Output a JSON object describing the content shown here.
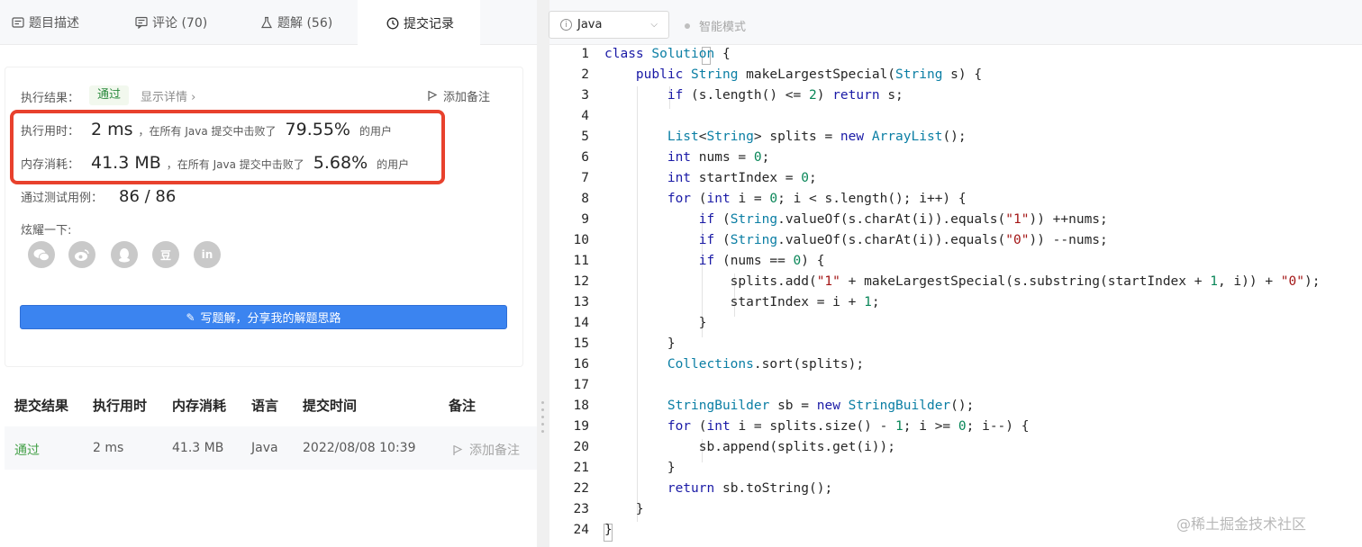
{
  "tabs": [
    {
      "label": "题目描述",
      "icon": "description-icon"
    },
    {
      "label": "评论 (70)",
      "icon": "comment-icon"
    },
    {
      "label": "题解 (56)",
      "icon": "flask-icon"
    },
    {
      "label": "提交记录",
      "icon": "clock-icon"
    }
  ],
  "result": {
    "label": "执行结果：",
    "status": "通过",
    "detail": "显示详情 ›",
    "add_note": "添加备注"
  },
  "stats": {
    "runtime_label": "执行用时：",
    "runtime_value": "2 ms",
    "runtime_mid": "，在所有 Java 提交中击败了",
    "runtime_pct": "79.55%",
    "runtime_suffix": "的用户",
    "memory_label": "内存消耗：",
    "memory_value": "41.3 MB",
    "memory_mid": "，在所有 Java 提交中击败了",
    "memory_pct": "5.68%",
    "memory_suffix": "的用户",
    "tests_label": "通过测试用例：",
    "tests_value": "86 / 86"
  },
  "share": {
    "label": "炫耀一下:",
    "icons": [
      "wechat-icon",
      "weibo-icon",
      "qq-icon",
      "douban-icon",
      "linkedin-icon"
    ],
    "douban_glyph": "豆",
    "linkedin_glyph": "in"
  },
  "write_button": "写题解，分享我的解题思路",
  "table": {
    "headers": [
      "提交结果",
      "执行用时",
      "内存消耗",
      "语言",
      "提交时间",
      "备注"
    ],
    "row": {
      "result": "通过",
      "runtime": "2 ms",
      "memory": "41.3 MB",
      "language": "Java",
      "time": "2022/08/08 10:39",
      "note": "添加备注"
    }
  },
  "editor": {
    "language": "Java",
    "smart_mode": "智能模式",
    "line_numbers": [
      "1",
      "2",
      "3",
      "4",
      "5",
      "6",
      "7",
      "8",
      "9",
      "10",
      "11",
      "12",
      "13",
      "14",
      "15",
      "16",
      "17",
      "18",
      "19",
      "20",
      "21",
      "22",
      "23",
      "24"
    ]
  },
  "watermark": "@稀土掘金技术社区",
  "colors": {
    "accent_blue": "#3b84f0",
    "pass_green": "#43a047",
    "highlight_red": "#e8412d"
  }
}
